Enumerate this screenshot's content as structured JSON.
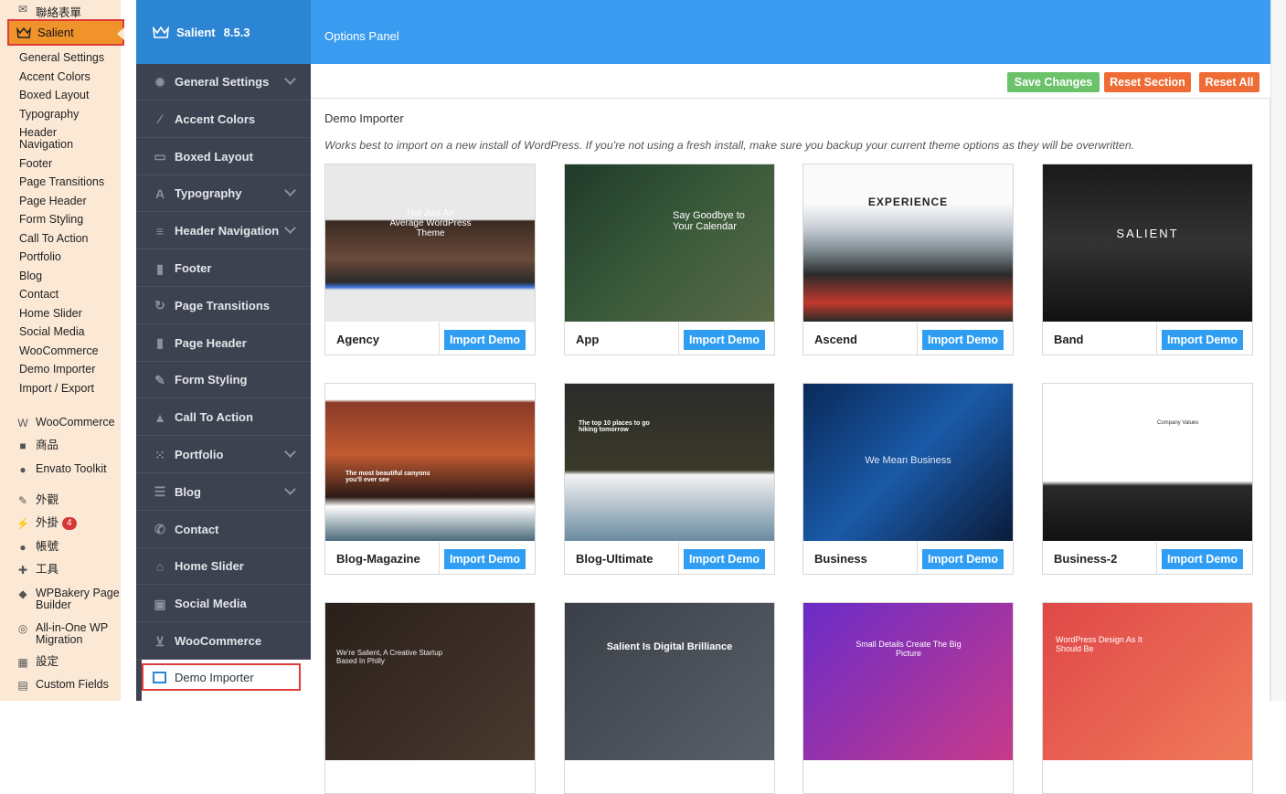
{
  "wp_admin": {
    "top_item": "聯絡表單",
    "active_item": "Salient",
    "sub_items": [
      "General Settings",
      "Accent Colors",
      "Boxed Layout",
      "Typography",
      "Header Navigation",
      "Footer",
      "Page Transitions",
      "Page Header",
      "Form Styling",
      "Call To Action",
      "Portfolio",
      "Blog",
      "Contact",
      "Home Slider",
      "Social Media",
      "WooCommerce",
      "Demo Importer",
      "Import / Export"
    ],
    "menu_items": [
      {
        "label": "WooCommerce",
        "icon": "woo-icon"
      },
      {
        "label": "商品",
        "icon": "box-icon"
      },
      {
        "label": "Envato Toolkit",
        "icon": "leaf-icon"
      },
      {
        "label": "外觀",
        "icon": "brush-icon"
      },
      {
        "label": "外掛",
        "icon": "plug-icon",
        "badge": "4"
      },
      {
        "label": "帳號",
        "icon": "user-icon"
      },
      {
        "label": "工具",
        "icon": "wrench-icon"
      },
      {
        "label": "WPBakery Page Builder",
        "icon": "wpbakery-icon"
      },
      {
        "label": "All-in-One WP Migration",
        "icon": "migration-icon"
      },
      {
        "label": "設定",
        "icon": "settings-icon"
      },
      {
        "label": "Custom Fields",
        "icon": "fields-icon"
      }
    ]
  },
  "panel": {
    "brand": "Salient",
    "version": "8.5.3",
    "header_title": "Options Panel",
    "nav": [
      {
        "label": "General Settings",
        "icon": "gear-icon",
        "chevron": true
      },
      {
        "label": "Accent Colors",
        "icon": "pencil-icon",
        "chevron": false
      },
      {
        "label": "Boxed Layout",
        "icon": "layout-icon",
        "chevron": false
      },
      {
        "label": "Typography",
        "icon": "font-icon",
        "chevron": true
      },
      {
        "label": "Header Navigation",
        "icon": "menu-icon",
        "chevron": true
      },
      {
        "label": "Footer",
        "icon": "doc-icon",
        "chevron": false
      },
      {
        "label": "Page Transitions",
        "icon": "refresh-icon",
        "chevron": false
      },
      {
        "label": "Page Header",
        "icon": "doc-icon",
        "chevron": false
      },
      {
        "label": "Form Styling",
        "icon": "edit-icon",
        "chevron": false
      },
      {
        "label": "Call To Action",
        "icon": "bell-icon",
        "chevron": false
      },
      {
        "label": "Portfolio",
        "icon": "grid-icon",
        "chevron": true
      },
      {
        "label": "Blog",
        "icon": "list-icon",
        "chevron": true
      },
      {
        "label": "Contact",
        "icon": "phone-icon",
        "chevron": false
      },
      {
        "label": "Home Slider",
        "icon": "home-icon",
        "chevron": false
      },
      {
        "label": "Social Media",
        "icon": "share-icon",
        "chevron": false
      },
      {
        "label": "WooCommerce",
        "icon": "cart-icon",
        "chevron": false
      }
    ],
    "active_nav": "Demo Importer"
  },
  "toolbar": {
    "save": "Save Changes",
    "reset_section": "Reset Section",
    "reset_all": "Reset All"
  },
  "section": {
    "title": "Demo Importer",
    "description": "Works best to import on a new install of WordPress. If you're not using a fresh install, make sure you backup your current theme options as they will be overwritten."
  },
  "import_label": "Import Demo",
  "demos": [
    {
      "name": "Agency",
      "thumb_text": "Not Just An Average WordPress Theme"
    },
    {
      "name": "App",
      "thumb_text": "Say Goodbye to Your Calendar"
    },
    {
      "name": "Ascend",
      "thumb_text": "EXPERIENCE"
    },
    {
      "name": "Band",
      "thumb_text": "SALIENT"
    },
    {
      "name": "Blog-Magazine",
      "thumb_text": "The most beautiful canyons you'll ever see"
    },
    {
      "name": "Blog-Ultimate",
      "thumb_text": "The top 10 places to go hiking tomorrow"
    },
    {
      "name": "Business",
      "thumb_text": "We Mean Business"
    },
    {
      "name": "Business-2",
      "thumb_text": "Company Values"
    },
    {
      "name": "",
      "thumb_text": "We're Salient, A Creative Startup Based In Philly"
    },
    {
      "name": "",
      "thumb_text": "Salient Is Digital Brilliance"
    },
    {
      "name": "",
      "thumb_text": "Small Details Create The Big Picture"
    },
    {
      "name": "",
      "thumb_text": "WordPress Design As It Should Be"
    }
  ],
  "colors": {
    "accent": "#2f9ef2",
    "save": "#6bc26b",
    "reset": "#ef6c34",
    "header": "#3a9cf0"
  }
}
